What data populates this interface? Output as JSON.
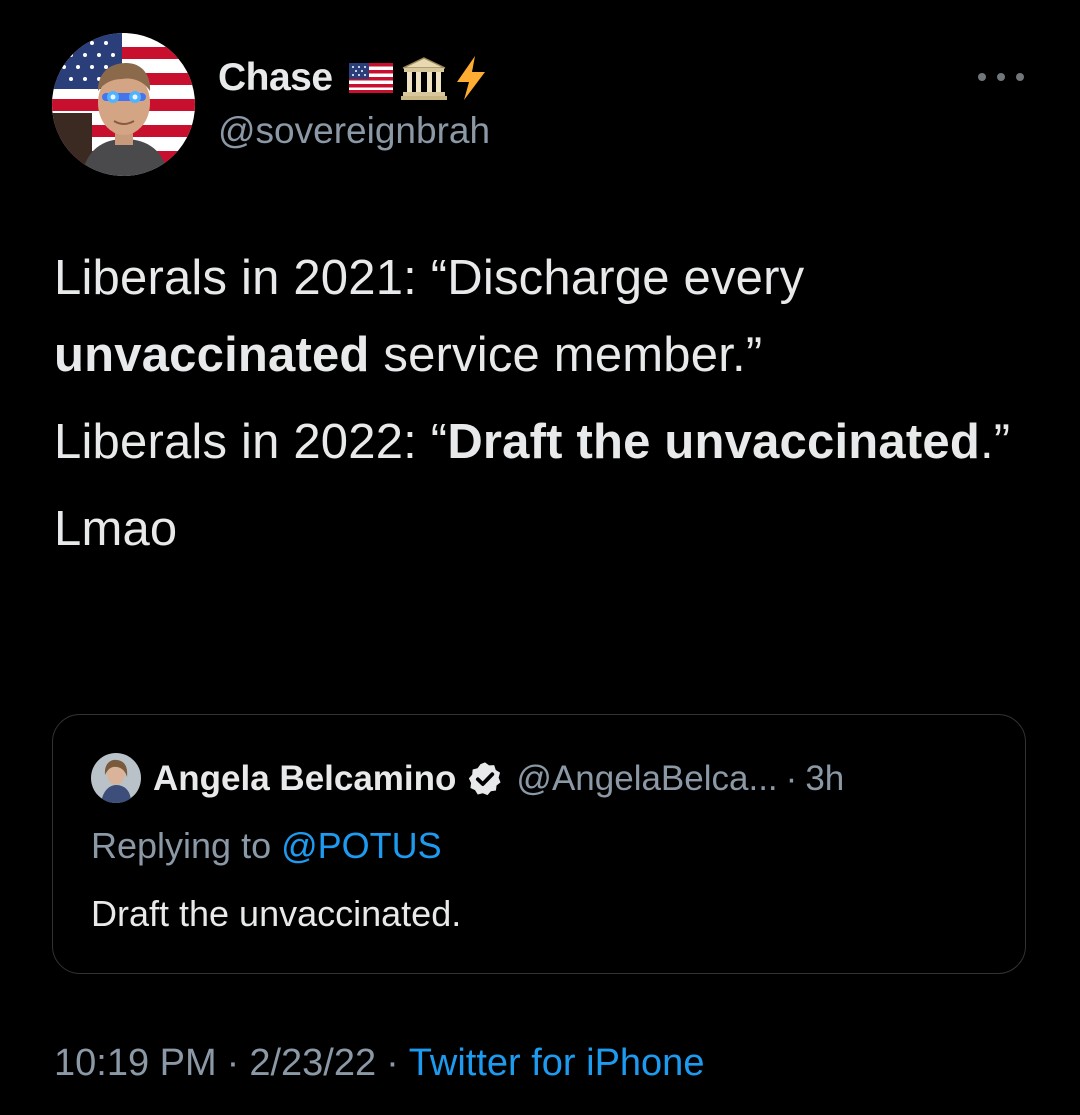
{
  "author": {
    "name": "Chase",
    "handle": "@sovereignbrah",
    "badges": [
      "us-flag-icon",
      "classical-building-icon",
      "lightning-icon"
    ]
  },
  "tweet": {
    "paragraph1_a": "Liberals in 2021: “Discharge every ",
    "paragraph1_b": "unvaccinated",
    "paragraph1_c": " service member.”",
    "paragraph2_a": "Liberals in 2022: “",
    "paragraph2_b": "Draft the unvaccinated",
    "paragraph2_c": ".”",
    "paragraph3": "Lmao"
  },
  "quote": {
    "name": "Angela Belcamino",
    "handle": "@AngelaBelca...",
    "separator": "·",
    "time": "3h",
    "replying_prefix": "Replying to ",
    "replying_to": "@POTUS",
    "text": "Draft the unvaccinated."
  },
  "footer": {
    "time": "10:19 PM",
    "separator": "·",
    "date": "2/23/22",
    "source": "Twitter for iPhone"
  },
  "colors": {
    "background": "#000000",
    "primary_text": "#e7e9ea",
    "secondary_text": "#8b98a5",
    "accent": "#1d9bf0",
    "border": "#2f3336"
  }
}
